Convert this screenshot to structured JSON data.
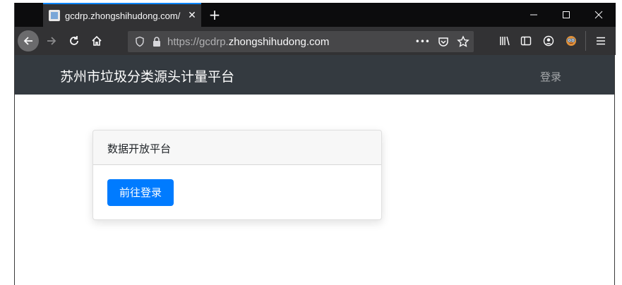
{
  "browser": {
    "tab_title": "gcdrp.zhongshihudong.com/",
    "tab_close": "✕",
    "new_tab": "+",
    "url_prefix": "https://gcdrp.",
    "url_host": "zhongshihudong.com",
    "page_actions": "•••"
  },
  "site": {
    "brand": "苏州市垃圾分类源头计量平台",
    "nav_login": "登录"
  },
  "card": {
    "header": "数据开放平台",
    "button_label": "前往登录"
  },
  "colors": {
    "navbar": "#343a40",
    "primary": "#007bff",
    "tab_accent": "#0a84ff"
  }
}
